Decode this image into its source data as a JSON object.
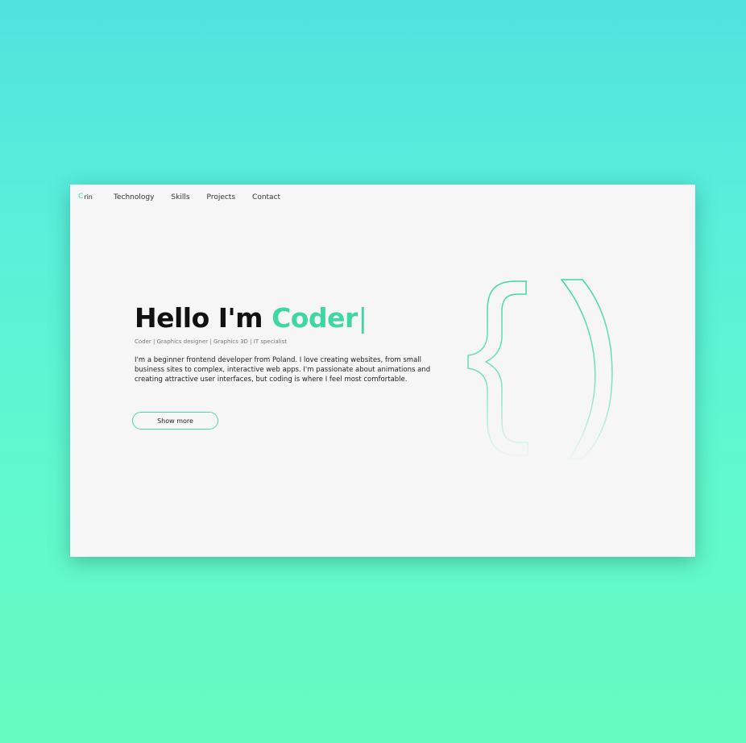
{
  "nav": {
    "logo_text": "rin",
    "links": [
      "Technology",
      "Skills",
      "Projects",
      "Contact"
    ]
  },
  "hero": {
    "title_prefix": "Hello I'm",
    "title_accent": "Coder",
    "cursor": "|",
    "subtitle": "Coder | Graphics designer | Graphics 3D | IT specialist",
    "description": "I'm a beginner frontend developer from Poland. I love creating websites, from small business sites to complex, interactive web apps. I'm passionate about animations and creating attractive user interfaces, but coding is where I feel most comfortable.",
    "button_label": "Show more"
  },
  "colors": {
    "accent": "#3ed7a4",
    "background_top": "#52e1de",
    "background_bottom": "#66fbc0",
    "page": "#f6f6f6"
  },
  "icons": {
    "logo": "c-logo-icon",
    "decoration": "curly-brace-outline-icon"
  }
}
